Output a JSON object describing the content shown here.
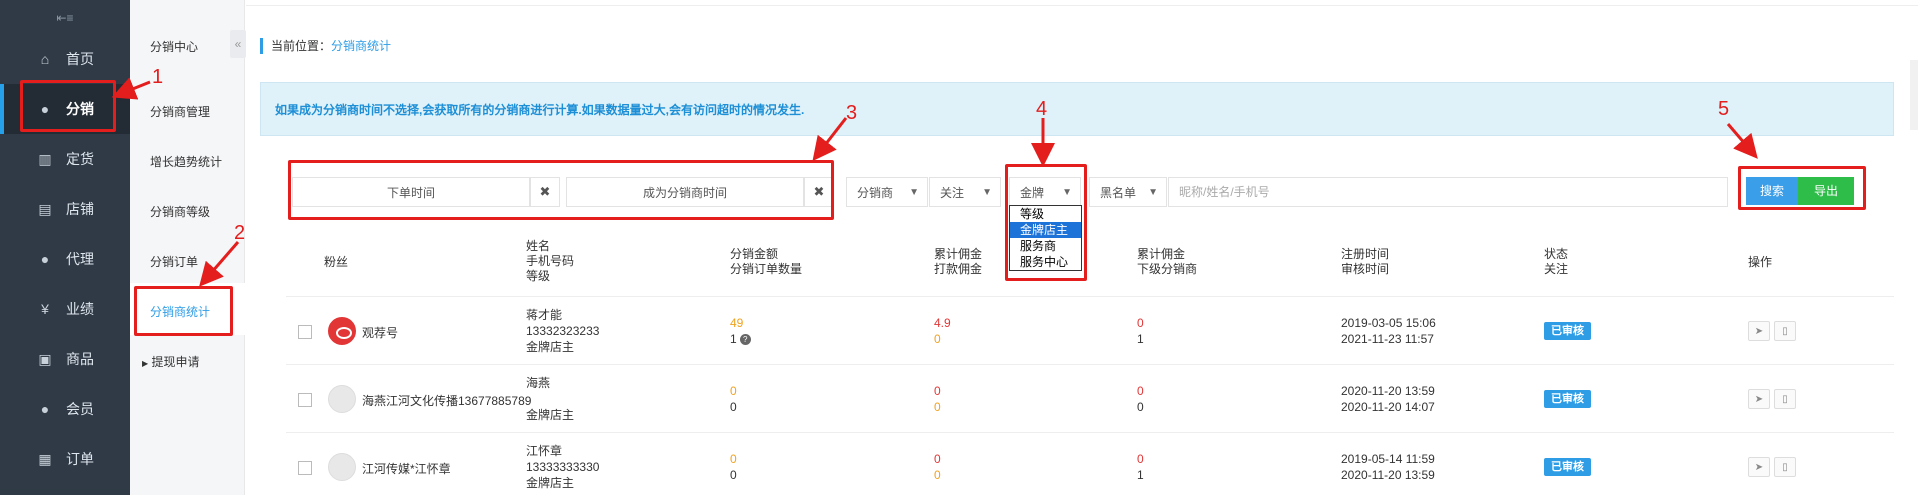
{
  "nav": {
    "top_icon": "menu-toggle-icon",
    "items": [
      {
        "label": "首页",
        "icon": "home-icon",
        "glyph": "⌂"
      },
      {
        "label": "分销",
        "icon": "user-icon",
        "glyph": "●"
      },
      {
        "label": "定货",
        "icon": "bar-chart-icon",
        "glyph": "▥"
      },
      {
        "label": "店铺",
        "icon": "shop-icon",
        "glyph": "▤"
      },
      {
        "label": "代理",
        "icon": "agent-icon",
        "glyph": "●"
      },
      {
        "label": "业绩",
        "icon": "yen-icon",
        "glyph": "¥"
      },
      {
        "label": "商品",
        "icon": "goods-icon",
        "glyph": "▣"
      },
      {
        "label": "会员",
        "icon": "member-icon",
        "glyph": "●"
      },
      {
        "label": "订单",
        "icon": "order-icon",
        "glyph": "▦"
      }
    ]
  },
  "subnav": {
    "collapse": "«",
    "items": [
      "分销中心",
      "分销商管理",
      "增长趋势统计",
      "分销商等级",
      "分销订单",
      "分销商统计"
    ],
    "withdraw": "提现申请"
  },
  "breadcrumb": {
    "prefix": "当前位置：",
    "current": "分销商统计"
  },
  "tip": "如果成为分销商时间不选择,会获取所有的分销商进行计算.如果数据量过大,会有访问超时的情况发生.",
  "filters": {
    "order_time": "下单时间",
    "become_time": "成为分销商时间",
    "clear": "✖",
    "distributor": "分销商",
    "follow": "关注",
    "level": "金牌",
    "blacklist": "黑名单",
    "search_placeholder": "昵称/姓名/手机号",
    "search_btn": "搜索",
    "export_btn": "导出"
  },
  "level_dropdown": {
    "options": [
      "等级",
      "金牌店主",
      "服务商",
      "服务中心"
    ],
    "highlighted": "金牌店主"
  },
  "annotations": [
    "1",
    "2",
    "3",
    "4",
    "5"
  ],
  "table": {
    "headers": {
      "fans": "粉丝",
      "name": [
        "姓名",
        "手机号码",
        "等级"
      ],
      "amount": [
        "分销金额",
        "分销订单数量"
      ],
      "commission": [
        "累计佣金",
        "打款佣金"
      ],
      "sub": [
        "累计佣金",
        "下级分销商"
      ],
      "time": [
        "注册时间",
        "审核时间"
      ],
      "status": [
        "状态",
        "关注"
      ],
      "op": "操作"
    },
    "rows": [
      {
        "fan": "观荐号",
        "avatar": "red",
        "name": "蒋才能",
        "phone": "13332323233",
        "level": "金牌店主",
        "amount": "49",
        "orders": "1",
        "commission": "4.9",
        "paid": "0",
        "sub_comm": "0",
        "sub_count": "1",
        "reg": "2019-03-05 15:06",
        "audit": "2021-11-23 11:57",
        "status": "已审核"
      },
      {
        "fan": "海燕江河文化传播13677885789",
        "avatar": "gray",
        "name": "海燕",
        "phone": "",
        "level": "金牌店主",
        "amount": "0",
        "orders": "0",
        "commission": "0",
        "paid": "0",
        "sub_comm": "0",
        "sub_count": "0",
        "reg": "2020-11-20 13:59",
        "audit": "2020-11-20 14:07",
        "status": "已审核"
      },
      {
        "fan": "江河传媒*江怀章",
        "avatar": "gray",
        "name": "江怀章",
        "phone": "13333333330",
        "level": "金牌店主",
        "amount": "0",
        "orders": "0",
        "commission": "0",
        "paid": "0",
        "sub_comm": "0",
        "sub_count": "1",
        "reg": "2019-05-14 11:59",
        "audit": "2020-11-20 13:59",
        "status": "已审核"
      }
    ]
  },
  "colors": {
    "accent": "#2e9de6",
    "annotation": "#e41d1d",
    "export": "#2fbd4a"
  }
}
